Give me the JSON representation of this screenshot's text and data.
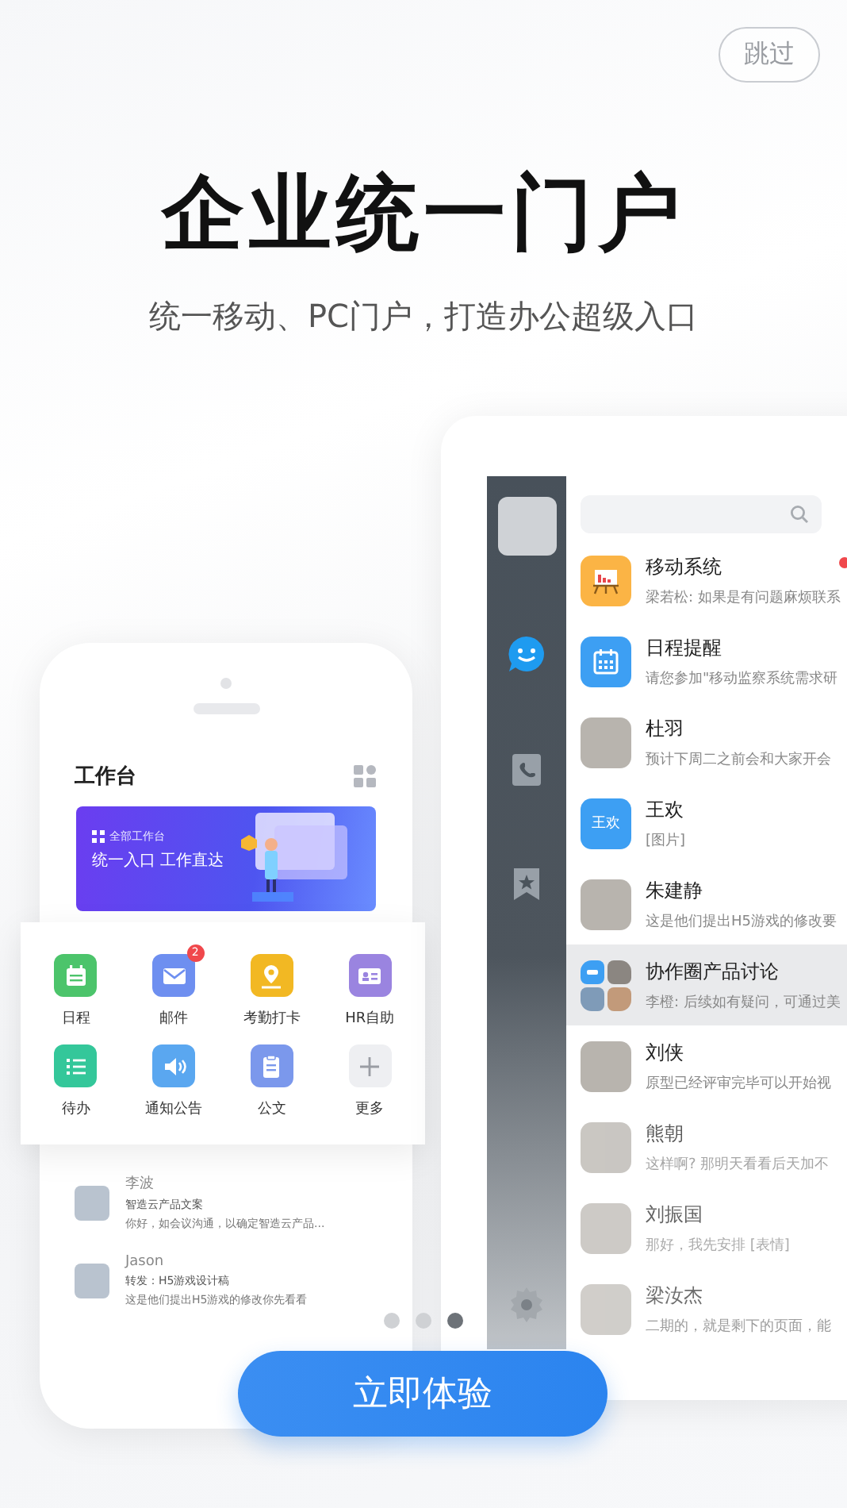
{
  "skip_button": "跳过",
  "title": "企业统一门户",
  "subtitle": "统一移动、PC门户，打造办公超级入口",
  "phone": {
    "header": "工作台",
    "banner": {
      "tag": "全部工作台",
      "headline": "统一入口 工作直达"
    },
    "apps": [
      {
        "label": "日程",
        "kind": "calendar",
        "color": "#4cc46b"
      },
      {
        "label": "邮件",
        "kind": "mail",
        "color": "#6e8ff0",
        "badge": "2"
      },
      {
        "label": "考勤打卡",
        "kind": "pin",
        "color": "#f2b823"
      },
      {
        "label": "HR自助",
        "kind": "card",
        "color": "#9a84e0"
      },
      {
        "label": "待办",
        "kind": "list",
        "color": "#34c79a"
      },
      {
        "label": "通知公告",
        "kind": "speaker",
        "color": "#5aa7f0"
      },
      {
        "label": "公文",
        "kind": "doc",
        "color": "#7b98ec"
      },
      {
        "label": "更多",
        "kind": "more",
        "color": "#eeeff2"
      }
    ],
    "messages": [
      {
        "name": "李波",
        "subject": "智造云产品文案",
        "preview": "你好，如会议沟通，以确定智造云产品..."
      },
      {
        "name": "Jason",
        "subject": "转发：H5游戏设计稿",
        "preview": "这是他们提出H5游戏的修改你先看看"
      }
    ]
  },
  "tablet": {
    "sidebar": [
      {
        "kind": "chat",
        "selected": true
      },
      {
        "kind": "contacts",
        "selected": false
      },
      {
        "kind": "bookmark",
        "selected": false
      },
      {
        "kind": "settings",
        "selected": false
      }
    ],
    "chats": [
      {
        "name": "移动系统",
        "preview": "梁若松: 如果是有问题麻烦联系",
        "kind": "app",
        "unread": true,
        "selected": false
      },
      {
        "name": "日程提醒",
        "preview": "请您参加\"移动监察系统需求研",
        "kind": "calendar",
        "unread": false,
        "selected": false
      },
      {
        "name": "杜羽",
        "preview": "预计下周二之前会和大家开会",
        "kind": "photo",
        "unread": false,
        "selected": false
      },
      {
        "name": "王欢",
        "preview": "[图片]",
        "kind": "initials",
        "avatar_text": "王欢",
        "unread": false,
        "selected": false
      },
      {
        "name": "朱建静",
        "preview": "这是他们提出H5游戏的修改要",
        "kind": "photo",
        "unread": false,
        "selected": false
      },
      {
        "name": "协作圈产品讨论",
        "preview": "李橙: 后续如有疑问，可通过美",
        "kind": "group",
        "unread": false,
        "selected": true
      },
      {
        "name": "刘侠",
        "preview": "原型已经评审完毕可以开始视",
        "kind": "photo",
        "unread": false,
        "selected": false
      },
      {
        "name": "熊朝",
        "preview": "这样啊? 那明天看看后天加不",
        "kind": "photo",
        "unread": false,
        "selected": false
      },
      {
        "name": "刘振国",
        "preview": "那好，我先安排 [表情]",
        "kind": "photo",
        "unread": false,
        "selected": false
      },
      {
        "name": "梁汝杰",
        "preview": "二期的，就是剩下的页面，能",
        "kind": "photo",
        "unread": false,
        "selected": false
      }
    ]
  },
  "pager": [
    {
      "selected": false
    },
    {
      "selected": false
    },
    {
      "selected": true
    }
  ],
  "cta": "立即体验"
}
